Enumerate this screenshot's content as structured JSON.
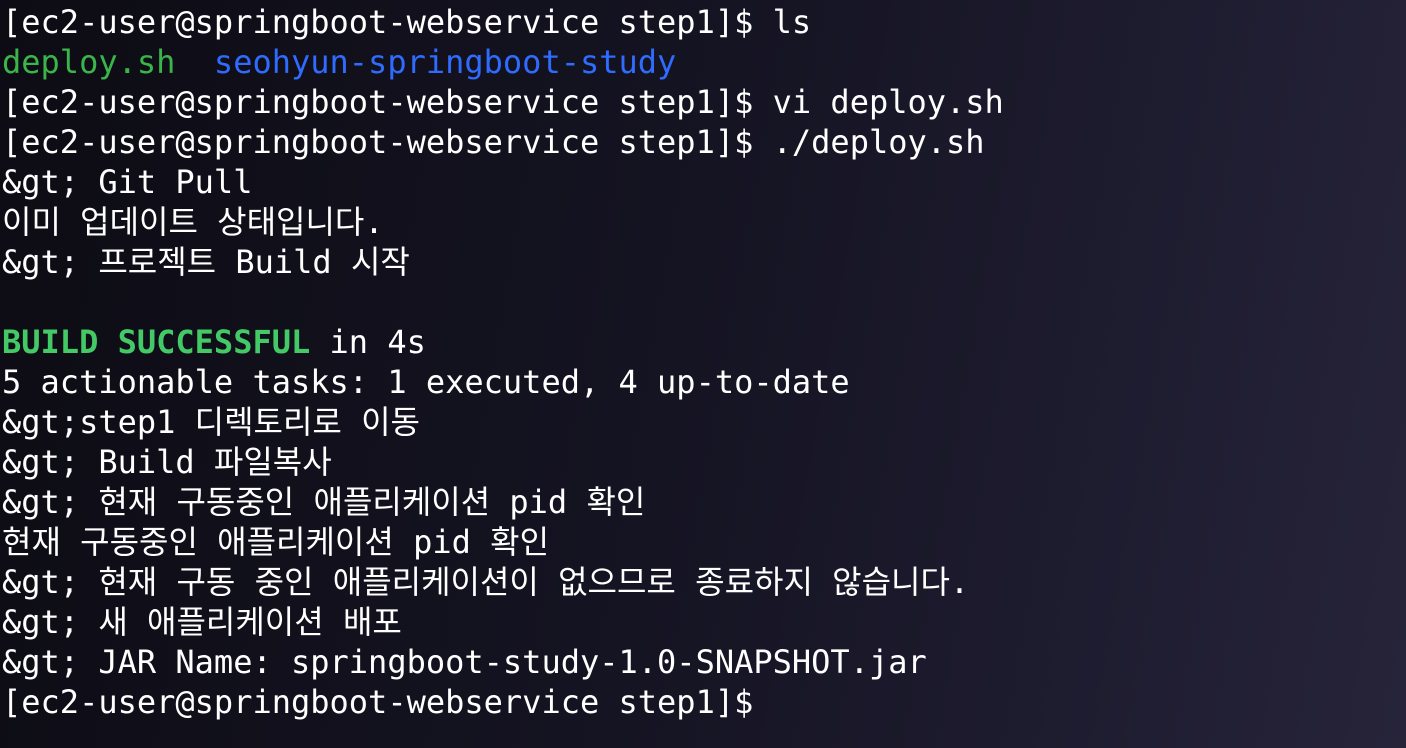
{
  "colors": {
    "background": "#151422",
    "text": "#ffffff",
    "exec_file": "#39b54a",
    "directory": "#2f6bff",
    "build_success": "#43c965"
  },
  "lines": {
    "l0_prompt": "[ec2-user@springboot-webservice step1]$ ",
    "l0_cmd": "ls",
    "l1_file1": "deploy.sh",
    "l1_sep": "  ",
    "l1_file2": "seohyun-springboot-study",
    "l2_prompt": "[ec2-user@springboot-webservice step1]$ ",
    "l2_cmd": "vi deploy.sh",
    "l3_prompt": "[ec2-user@springboot-webservice step1]$ ",
    "l3_cmd": "./deploy.sh",
    "l4": "&gt; Git Pull",
    "l5": "이미 업데이트 상태입니다.",
    "l6": "&gt; 프로젝트 Build 시작",
    "l7": "",
    "l8_success": "BUILD SUCCESSFUL",
    "l8_rest": " in 4s",
    "l9": "5 actionable tasks: 1 executed, 4 up-to-date",
    "l10": "&gt;step1 디렉토리로 이동",
    "l11": "&gt; Build 파일복사",
    "l12": "&gt; 현재 구동중인 애플리케이션 pid 확인",
    "l13": "현재 구동중인 애플리케이션 pid 확인",
    "l14": "&gt; 현재 구동 중인 애플리케이션이 없으므로 종료하지 않습니다.",
    "l15": "&gt; 새 애플리케이션 배포",
    "l16": "&gt; JAR Name: springboot-study-1.0-SNAPSHOT.jar",
    "l17_prompt": "[ec2-user@springboot-webservice step1]$ "
  }
}
